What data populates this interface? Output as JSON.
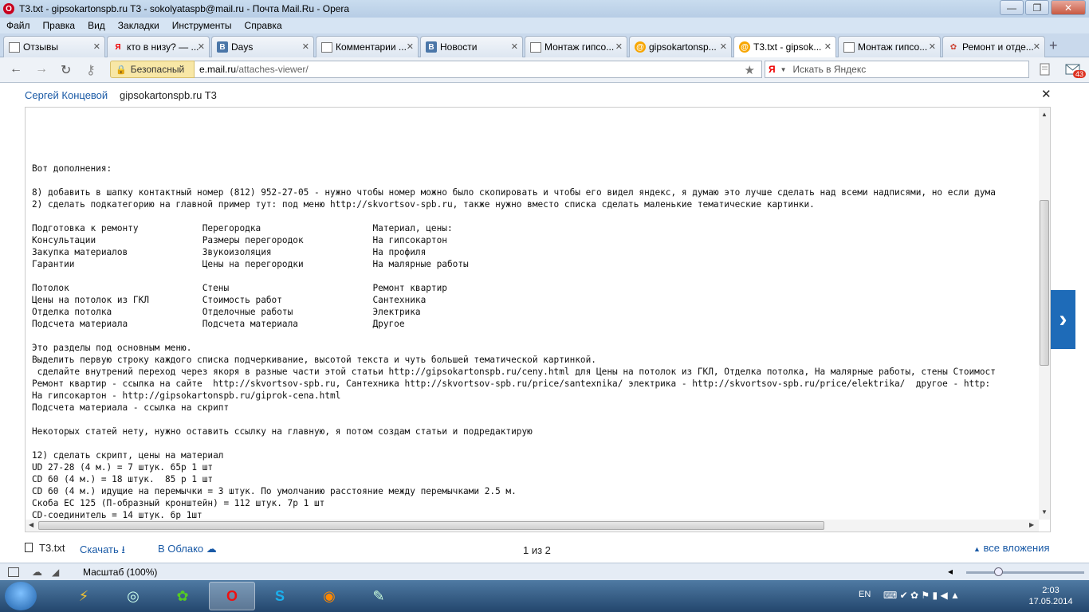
{
  "window": {
    "title": "T3.txt - gipsokartonspb.ru T3 - sokolyataspb@mail.ru - Почта Mail.Ru - Opera",
    "minimize": "—",
    "maximize": "❐",
    "close": "✕"
  },
  "menu": [
    "Файл",
    "Правка",
    "Вид",
    "Закладки",
    "Инструменты",
    "Справка"
  ],
  "tabs": [
    {
      "label": "Отзывы",
      "icon": "page"
    },
    {
      "label": "кто в низу? — ...",
      "icon": "yandex"
    },
    {
      "label": "Days",
      "icon": "vk"
    },
    {
      "label": "Комментарии ...",
      "icon": "page"
    },
    {
      "label": "Новости",
      "icon": "vk"
    },
    {
      "label": "Монтаж гипсо...",
      "icon": "page"
    },
    {
      "label": "gipsokartonsp...",
      "icon": "mail"
    },
    {
      "label": "T3.txt - gipsok...",
      "icon": "mail",
      "active": true
    },
    {
      "label": "Монтаж гипсо...",
      "icon": "page"
    },
    {
      "label": "Ремонт и отде...",
      "icon": "flower"
    }
  ],
  "address": {
    "secure_label": "Безопасный",
    "url_domain": "e.mail.ru",
    "url_path": "/attaches-viewer/",
    "search_placeholder": "Искать в Яндекс",
    "mail_count": "43"
  },
  "viewer": {
    "sender": "Сергей Концевой",
    "subject": "gipsokartonspb.ru T3",
    "close": "✕",
    "next": "›",
    "lines": [
      "Вот дополнения:",
      "",
      "8) добавить в шапку контактный номер (812) 952-27-05 - нужно чтобы номер можно было скопировать и чтобы его видел яндекс, я думаю это лучше сделать над всеми надписями, но если дума",
      "2) сделать подкатегорию на главной пример тут: под меню http://skvortsov-spb.ru, также нужно вместо списка сделать маленькие тематические картинки.",
      "",
      "Подготовка к ремонту            Перегородка                     Материал, цены:",
      "Консультации                    Размеры перегородок             На гипсокартон",
      "Закупка материалов              Звукоизоляция                   На профиля",
      "Гарантии                        Цены на перегородки             На малярные работы",
      "",
      "Потолок                         Стены                           Ремонт квартир",
      "Цены на потолок из ГКЛ          Стоимость работ                 Сантехника",
      "Отделка потолка                 Отделочные работы               Электрика",
      "Подсчета материала              Подсчета материала              Другое",
      "",
      "Это разделы под основным меню.",
      "Выделить первую строку каждого списка подчеркивание, высотой текста и чуть большей тематической картинкой.",
      " сделайте внутрений переход через якоря в разные части этой статьи http://gipsokartonspb.ru/ceny.html для Цены на потолок из ГКЛ, Отделка потолка, На малярные работы, стены Стоимост",
      "Ремонт квартир - ссылка на сайте  http://skvortsov-spb.ru, Сантехника http://skvortsov-spb.ru/price/santexnika/ электрика - http://skvortsov-spb.ru/price/elektrika/  другое - http:",
      "На гипсокартон - http://gipsokartonspb.ru/giprok-cena.html",
      "Подсчета материала - ссылка на скрипт",
      "",
      "Некоторых статей нету, нужно оставить ссылку на главную, я потом создам статьи и подредактирую",
      "",
      "12) сделать скрипт, цены на материал",
      "UD 27-28 (4 м.) = 7 штук. 65р 1 шт",
      "CD 60 (4 м.) = 18 штук.  85 р 1 шт",
      "CD 60 (4 м.) идущие на перемычки = 3 штук. По умолчанию расстояние между перемычками 2.5 м.",
      "Скоба ЕС 125 (П-образный кронштейн) = 112 штук. 7р 1 шт",
      "CD-соединитель = 14 штук. 6р 1шт"
    ]
  },
  "footer": {
    "filename": "T3.txt",
    "download": "Скачать",
    "cloud": "В Облако",
    "pager": "1 из 2",
    "all_attachments": "все вложения"
  },
  "status": {
    "zoom": "Масштаб (100%)"
  },
  "taskbar": {
    "lang": "EN",
    "time": "2:03",
    "date": "17.05.2014"
  }
}
